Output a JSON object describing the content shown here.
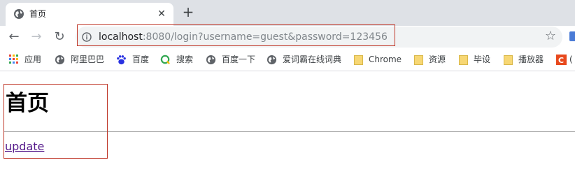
{
  "browser": {
    "tab_title": "首页",
    "tab_close": "✕",
    "new_tab": "+",
    "back": "←",
    "forward": "→",
    "reload": "↻",
    "url_host": "localhost",
    "url_rest": ":8080/login?username=guest&password=123456",
    "bookmark_star": "☆"
  },
  "bookmarks": [
    {
      "label": "应用",
      "icon": "apps-grid-icon"
    },
    {
      "label": "阿里巴巴",
      "icon": "globe-icon"
    },
    {
      "label": "百度",
      "icon": "baidu-paw-icon"
    },
    {
      "label": "搜索",
      "icon": "search-q-icon"
    },
    {
      "label": "百度一下",
      "icon": "globe-icon"
    },
    {
      "label": "爱词霸在线词典",
      "icon": "globe-icon"
    },
    {
      "label": "Chrome",
      "icon": "folder-icon"
    },
    {
      "label": "资源",
      "icon": "folder-icon"
    },
    {
      "label": "毕设",
      "icon": "folder-icon"
    },
    {
      "label": "播放器",
      "icon": "folder-icon"
    },
    {
      "label": "(",
      "icon": "c-icon"
    }
  ],
  "page": {
    "heading": "首页",
    "link": "update"
  },
  "colors": {
    "tabstrip": "#dee1e6",
    "omnibox": "#f1f3f4",
    "annotation_box": "#c0392b",
    "visited_link": "#551a8b",
    "folder": "#f7d774"
  }
}
